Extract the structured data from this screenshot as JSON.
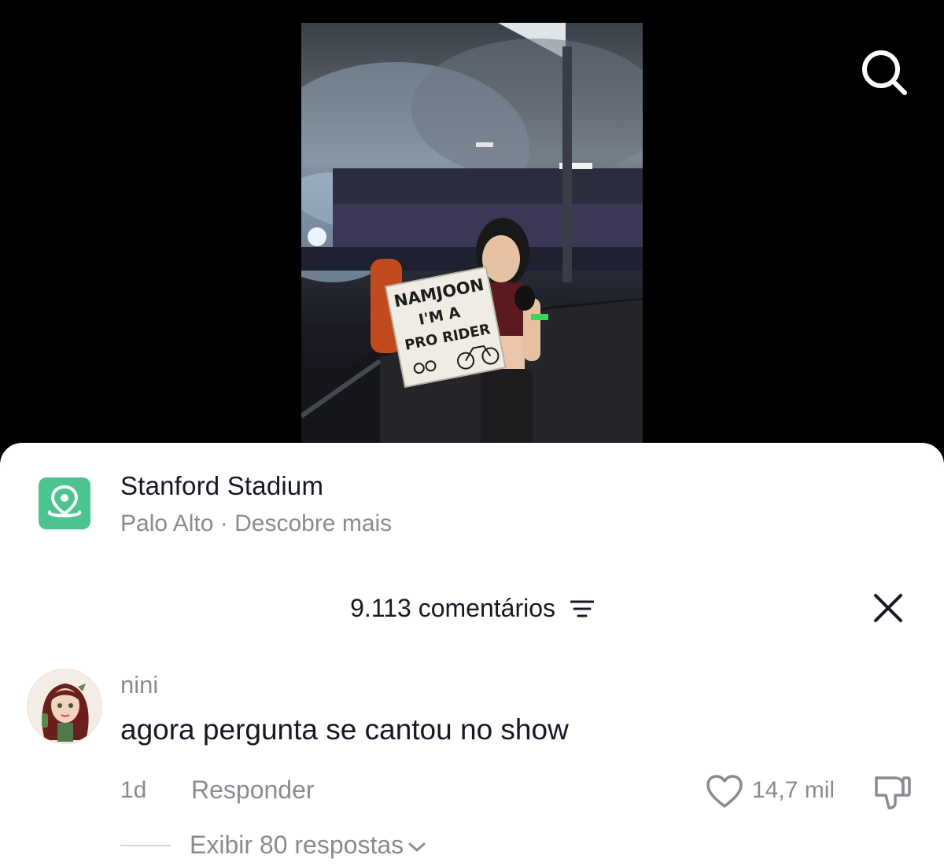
{
  "location": {
    "title": "Stanford Stadium",
    "city": "Palo Alto",
    "separator": " · ",
    "discover": "Descobre mais",
    "icon": "location-pin-icon",
    "icon_color": "#4cc48f"
  },
  "photo": {
    "sign_line1": "NAMJOON",
    "sign_line2": "I'M A",
    "sign_line3": "PRO RIDER"
  },
  "comments": {
    "count_label": "9.113 comentários",
    "filter_icon": "filter-icon",
    "close_icon": "close-icon"
  },
  "comment": {
    "username": "nini",
    "text": "agora pergunta se cantou no show",
    "time": "1d",
    "reply_label": "Responder",
    "likes": "14,7 mil",
    "replies_label": "Exibir 80 respostas"
  },
  "colors": {
    "text_primary": "#161823",
    "text_secondary": "#8a8b91",
    "background_top": "#000000",
    "sheet": "#ffffff"
  }
}
